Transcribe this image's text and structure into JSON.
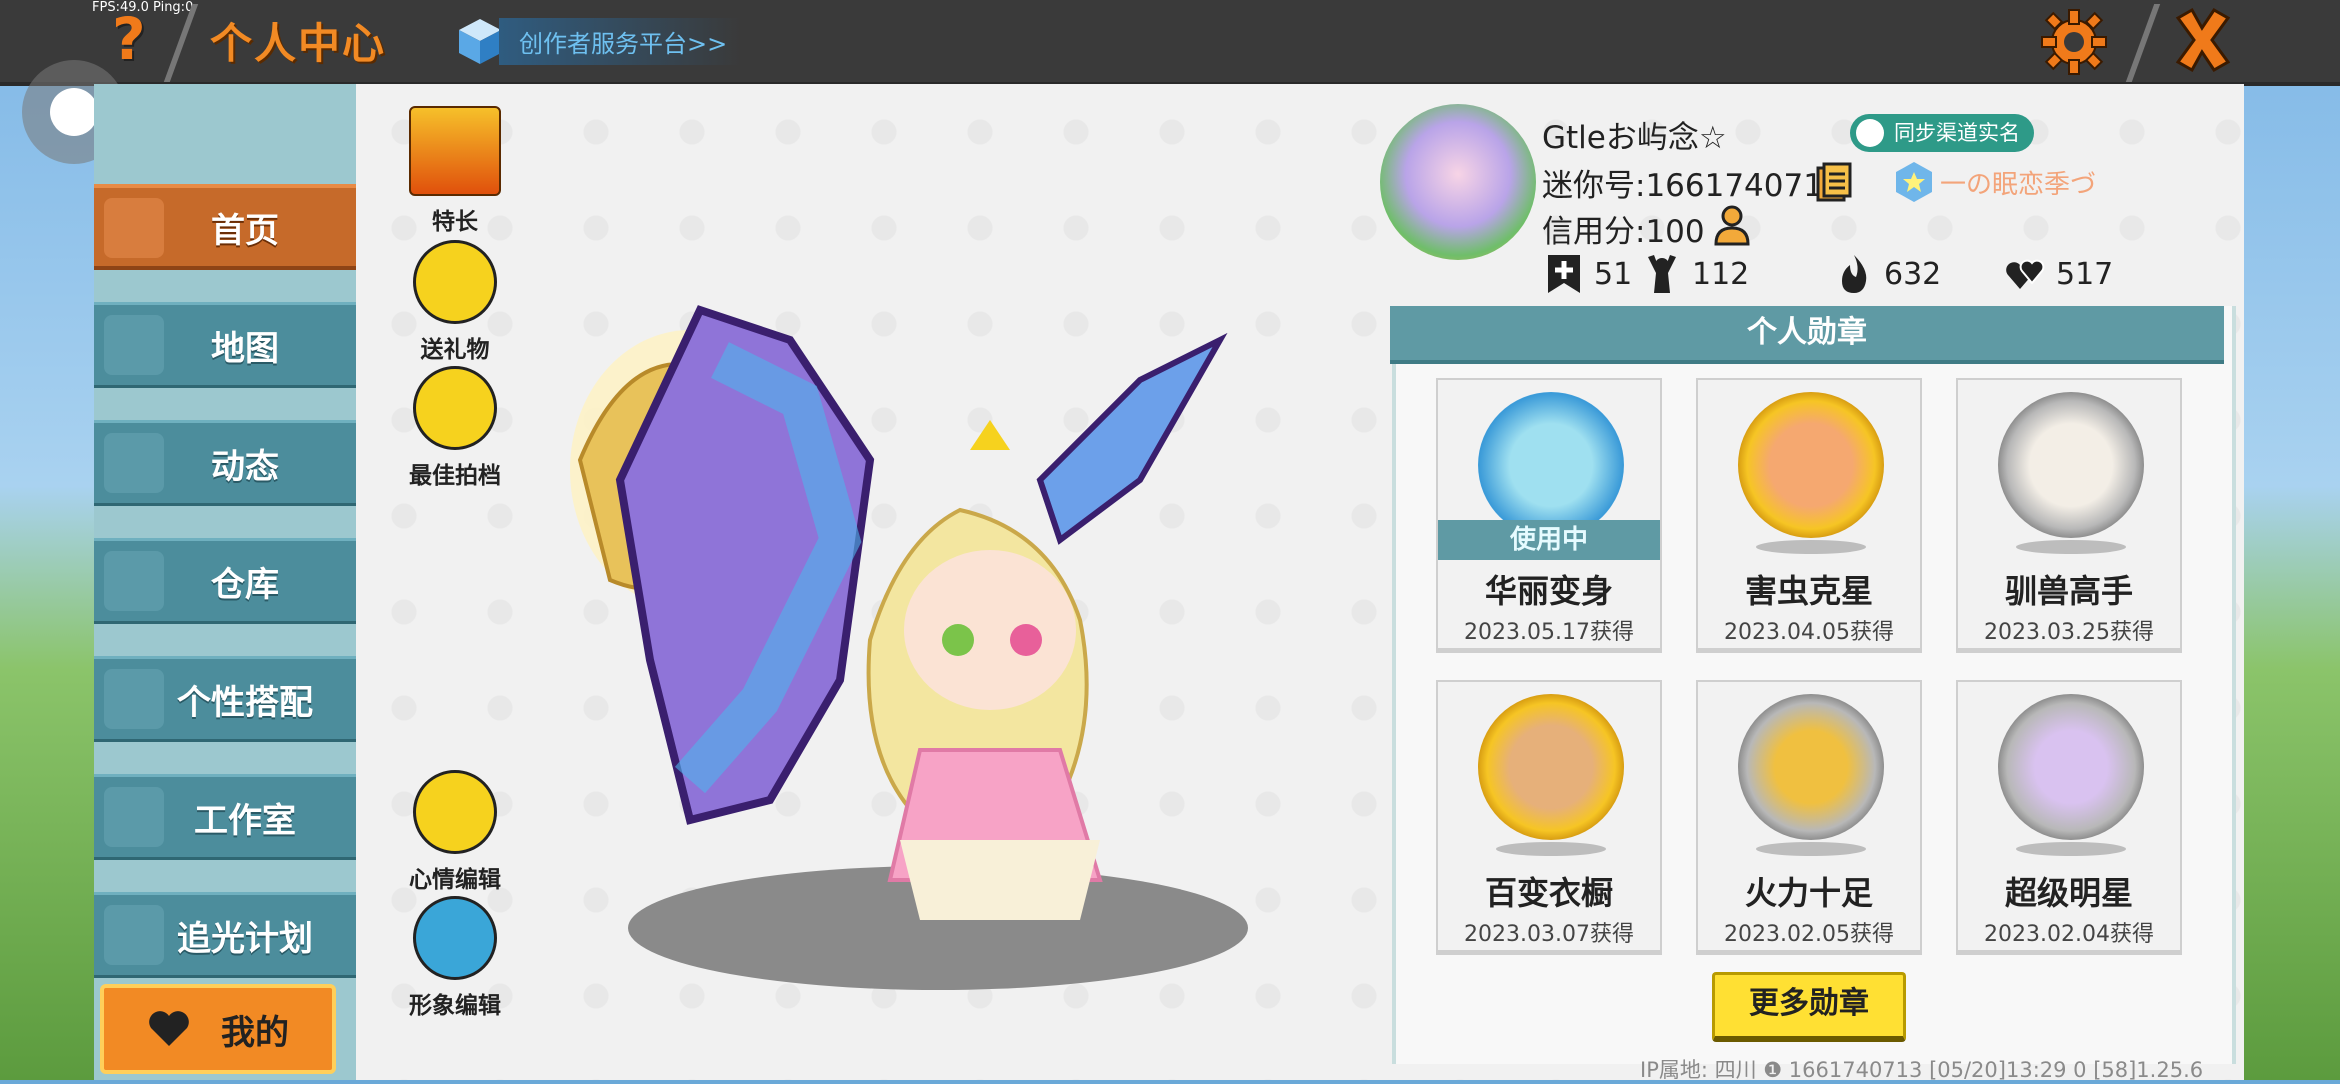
{
  "overlay": {
    "fps": "FPS:49.0  Ping:0"
  },
  "header": {
    "title": "个人中心",
    "platform_link": "创作者服务平台>>",
    "help_icon": "question-mark-icon",
    "settings_icon": "gear-icon",
    "close_icon": "close-x-icon"
  },
  "sidebar": {
    "items": [
      {
        "label": "首页",
        "icon": "home-icon",
        "active": true
      },
      {
        "label": "地图",
        "icon": "map-icon",
        "active": false
      },
      {
        "label": "动态",
        "icon": "bell-icon",
        "active": false
      },
      {
        "label": "仓库",
        "icon": "warehouse-icon",
        "active": false
      },
      {
        "label": "个性搭配",
        "icon": "outfit-icon",
        "active": false
      },
      {
        "label": "工作室",
        "icon": "studio-icon",
        "active": false
      },
      {
        "label": "追光计划",
        "icon": "spotlight-icon",
        "active": false
      }
    ],
    "mine": {
      "label": "我的",
      "icon": "heart-icon"
    }
  },
  "actions": {
    "specialty": "特长",
    "gift": "送礼物",
    "partner": "最佳拍档",
    "mood_edit": "心情编辑",
    "look_edit": "形象编辑"
  },
  "profile": {
    "name": "Gtleお屿念☆",
    "id_line": "迷你号:1661740713",
    "credit_line": "信用分:100",
    "sync_badge": "同步渠道实名",
    "clan": "一の眠恋季づ",
    "stats": {
      "plus": "51",
      "fans": "112",
      "fire": "632",
      "likes": "517"
    }
  },
  "badges": {
    "header": "个人勋章",
    "in_use_label": "使用中",
    "items": [
      {
        "name": "华丽变身",
        "date": "2023.05.17获得",
        "in_use": true
      },
      {
        "name": "害虫克星",
        "date": "2023.04.05获得",
        "in_use": false
      },
      {
        "name": "驯兽高手",
        "date": "2023.03.25获得",
        "in_use": false
      },
      {
        "name": "百变衣橱",
        "date": "2023.03.07获得",
        "in_use": false
      },
      {
        "name": "火力十足",
        "date": "2023.02.05获得",
        "in_use": false
      },
      {
        "name": "超级明星",
        "date": "2023.02.04获得",
        "in_use": false
      }
    ],
    "more_button": "更多勋章"
  },
  "footer": {
    "text": "IP属地: 四川 ❶    1661740713    [05/20]13:29 0   [58]1.25.6"
  },
  "colors": {
    "accent_orange": "#f28a24",
    "nav_teal": "#4c8d9c",
    "nav_active": "#c66a2a",
    "badge_header": "#5f9aa4",
    "more_button": "#ffe033"
  }
}
